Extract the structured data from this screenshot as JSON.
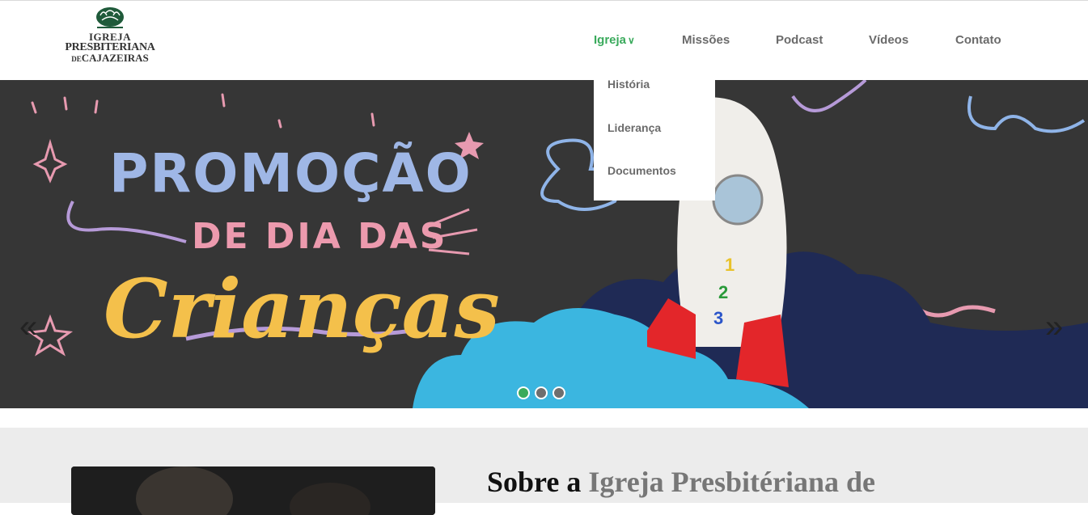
{
  "logo": {
    "line1": "IGREJA",
    "line2": "PRESBITERIANA",
    "line3_small": "DE",
    "line3": "CAJAZEIRAS",
    "color": "#1f5a3a"
  },
  "nav": {
    "items": [
      {
        "label": "Igreja",
        "active": true,
        "caret": "∨"
      },
      {
        "label": "Missões"
      },
      {
        "label": "Podcast"
      },
      {
        "label": "Vídeos"
      },
      {
        "label": "Contato"
      }
    ],
    "dropdown": [
      "História",
      "Liderança",
      "Documentos"
    ],
    "active_color": "#3aaa5c"
  },
  "hero": {
    "line1": "PROMOÇÃO",
    "line2": "DE DIA DAS",
    "line3": "Crianças",
    "rocket_numbers": [
      "1",
      "2",
      "3"
    ],
    "prev_icon": "«",
    "next_icon": "»",
    "slides": 3,
    "active_slide": 1
  },
  "about": {
    "title_a": "Sobre a",
    "title_b": "Igreja Presbitériana de"
  }
}
